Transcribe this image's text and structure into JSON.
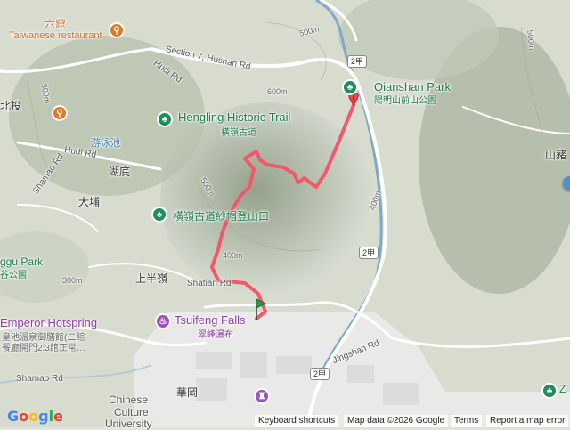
{
  "map": {
    "road_labels": [
      "Section 7, Hushan Rd",
      "Hudi Rd",
      "Hudi Rd",
      "Shamao Rd",
      "Shamao Rd",
      "Jingshan Rd",
      "Shatian Rd"
    ],
    "route_shields": [
      "2甲",
      "2甲",
      "2甲"
    ],
    "contours": [
      "500m",
      "500m",
      "400m",
      "400m",
      "300m",
      "300m",
      "500m",
      "600m"
    ],
    "places": [
      "北投",
      "湖底",
      "大埔",
      "上半嶺",
      "華岡",
      "山豬",
      "游泳池",
      "六窟"
    ],
    "pois": {
      "restaurant": {
        "cn": "六窟",
        "en": "Taiwanese restaurant"
      },
      "hengling": {
        "en": "Hengling Historic Trail",
        "cn": "橫嶺古道"
      },
      "trailhead": {
        "cn": "橫嶺古道紗帽登山口"
      },
      "qianshan": {
        "en": "Qianshan Park",
        "cn": "陽明山前山公園"
      },
      "tsuifeng": {
        "en": "Tsuifeng Falls",
        "cn": "翠峰瀑布"
      },
      "emperor": {
        "en": "Emperor Hotspring",
        "cn1": "皇池溫泉御膳館(二館",
        "cn2": "餐廳開門2:3館正常…"
      },
      "university": {
        "en1": "Chinese",
        "en2": "Culture",
        "en3": "University"
      },
      "park_left": {
        "en": "ggu Park",
        "cn": "谷公園"
      },
      "right_z": {
        "en": "Z"
      }
    },
    "icons": [
      "restaurant-icon",
      "park-icon",
      "hotspring-icon",
      "university-icon",
      "marker-icon"
    ],
    "colors": {
      "route": "#f0596b",
      "end_marker": "#e84d4d",
      "start_marker": "#2a9a4a",
      "road": "#ffffff",
      "terrain": "#c9d0c0"
    }
  },
  "footer": {
    "logo": "Google",
    "shortcuts": "Keyboard shortcuts",
    "mapdata": "Map data ©2026 Google",
    "terms": "Terms",
    "report": "Report a map error"
  }
}
